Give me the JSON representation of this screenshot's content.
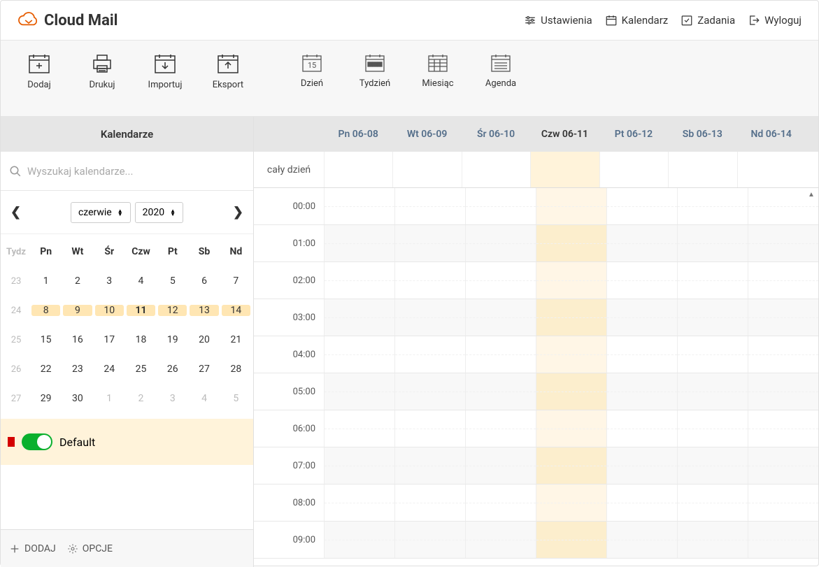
{
  "logo": {
    "text": "Cloud Mail"
  },
  "topnav": {
    "settings": "Ustawienia",
    "calendar": "Kalendarz",
    "tasks": "Zadania",
    "logout": "Wyloguj"
  },
  "toolbar": {
    "add": "Dodaj",
    "print": "Drukuj",
    "import": "Importuj",
    "export": "Eksport",
    "day": "Dzień",
    "day_num": "15",
    "week": "Tydzień",
    "month": "Miesiąc",
    "agenda": "Agenda"
  },
  "sidebar": {
    "title": "Kalendarze",
    "search_placeholder": "Wyszukaj kalendarze...",
    "month_label": "czerwie",
    "year_label": "2020",
    "mini": {
      "week_label": "Tydz",
      "dow": [
        "Pn",
        "Wt",
        "Śr",
        "Czw",
        "Pt",
        "Sb",
        "Nd"
      ],
      "rows": [
        {
          "wk": "23",
          "d": [
            "1",
            "2",
            "3",
            "4",
            "5",
            "6",
            "7"
          ],
          "hl": false
        },
        {
          "wk": "24",
          "d": [
            "8",
            "9",
            "10",
            "11",
            "12",
            "13",
            "14"
          ],
          "hl": true,
          "today": 3
        },
        {
          "wk": "25",
          "d": [
            "15",
            "16",
            "17",
            "18",
            "19",
            "20",
            "21"
          ],
          "hl": false
        },
        {
          "wk": "26",
          "d": [
            "22",
            "23",
            "24",
            "25",
            "26",
            "27",
            "28"
          ],
          "hl": false
        },
        {
          "wk": "27",
          "d": [
            "29",
            "30",
            "1",
            "2",
            "3",
            "4",
            "5"
          ],
          "hl": false,
          "dim_from": 2
        }
      ]
    },
    "calendars": [
      {
        "name": "Default",
        "color": "#d40000"
      }
    ],
    "footer": {
      "add": "DODAJ",
      "options": "OPCJE"
    }
  },
  "grid": {
    "days": [
      "Pn 06-08",
      "Wt 06-09",
      "Śr 06-10",
      "Czw 06-11",
      "Pt 06-12",
      "Sb 06-13",
      "Nd 06-14"
    ],
    "today_index": 3,
    "allday_label": "cały dzień",
    "hours": [
      "00:00",
      "01:00",
      "02:00",
      "03:00",
      "04:00",
      "05:00",
      "06:00",
      "07:00",
      "08:00",
      "09:00"
    ]
  }
}
